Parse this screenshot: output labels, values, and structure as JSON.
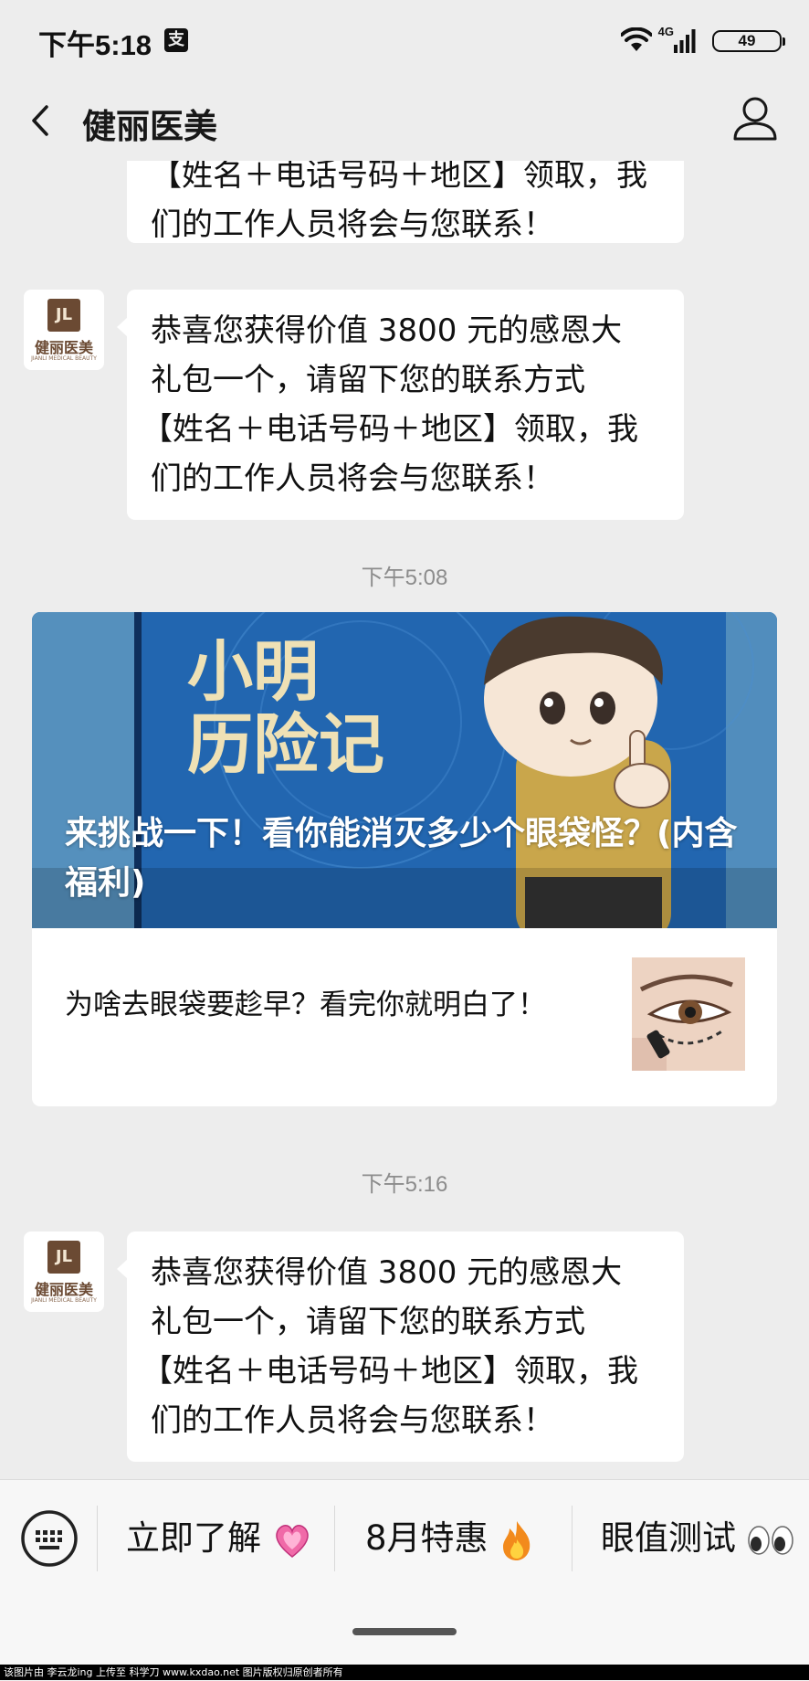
{
  "status": {
    "time": "下午5:18",
    "app_icon_glyph": "支",
    "network": "4G",
    "battery": "49"
  },
  "nav": {
    "title": "健丽医美"
  },
  "avatar": {
    "mark": "JL",
    "name": "健丽医美",
    "sub": "JIANLI MEDICAL BEAUTY"
  },
  "messages": [
    {
      "lines": [
        "【姓名＋电话号码＋地区】领取，我",
        "们的工作人员将会与您联系！"
      ]
    },
    {
      "lines": [
        "恭喜您获得价值 3800 元的感恩大",
        "礼包一个，请留下您的联系方式",
        "【姓名＋电话号码＋地区】领取，我",
        "们的工作人员将会与您联系！"
      ]
    },
    {
      "lines": [
        "恭喜您获得价值 3800 元的感恩大",
        "礼包一个，请留下您的联系方式",
        "【姓名＋电话号码＋地区】领取，我",
        "们的工作人员将会与您联系！"
      ]
    }
  ],
  "timestamps": [
    "下午5:08",
    "下午5:16"
  ],
  "article": {
    "cover_text_line1": "小明",
    "cover_text_line2": "历险记",
    "title": "来挑战一下！看你能消灭多少个眼袋怪？(内含福利)",
    "sub_title": "为啥去眼袋要趁早？看完你就明白了！"
  },
  "menu": {
    "items": [
      {
        "label": "立即了解",
        "icon": "heart-icon"
      },
      {
        "label": "8月特惠",
        "icon": "fire-icon"
      },
      {
        "label": "眼值测试",
        "icon": "eyes-icon"
      }
    ]
  },
  "watermark": "该图片由 李云龙ing 上传至 科学刀 www.kxdao.net 图片版权归原创者所有",
  "colors": {
    "background": "#ededed",
    "bubble": "#ffffff",
    "brand_brown": "#6b4a33",
    "cover_blue": "#2a6cb7"
  }
}
